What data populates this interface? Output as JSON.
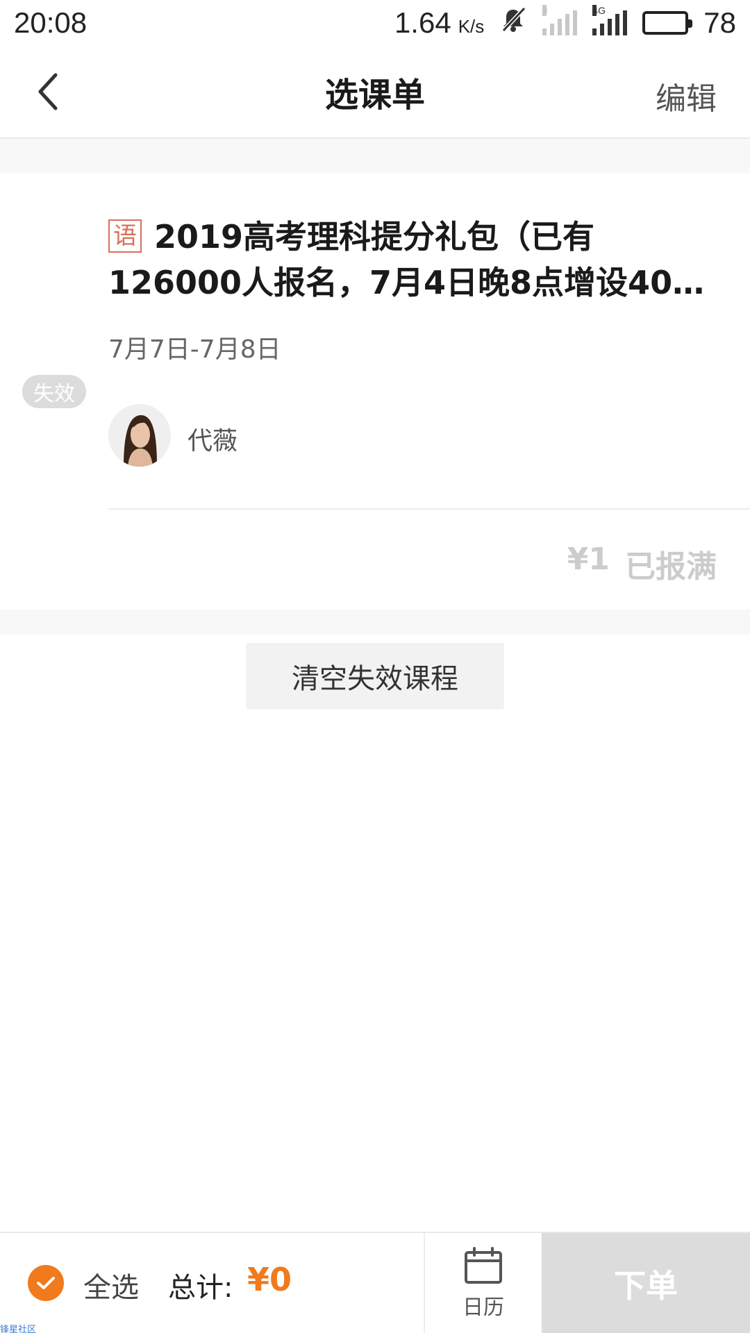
{
  "status_bar": {
    "time": "20:08",
    "net_speed": "1.64",
    "net_unit": "K/s",
    "sim1_label": "×",
    "sim2_label": "4G",
    "battery": "78"
  },
  "nav": {
    "title": "选课单",
    "edit_label": "编辑"
  },
  "course": {
    "subject_tag": "语",
    "title": "2019高考理科提分礼包（已有126000人报名，7月4日晚8点增设40…",
    "date": "7月7日-7月8日",
    "teacher": "代薇",
    "status_badge": "失效",
    "price": "¥1",
    "enroll_status": "已报满"
  },
  "clear_button_label": "清空失效课程",
  "bottom_bar": {
    "select_all_label": "全选",
    "total_label": "总计:",
    "total_amount": "¥0",
    "calendar_label": "日历",
    "order_label": "下单"
  },
  "watermark": "锋星社区",
  "colors": {
    "accent": "#f07a1c",
    "subject_tag": "#d8705c",
    "disabled": "#dcdcdc"
  }
}
